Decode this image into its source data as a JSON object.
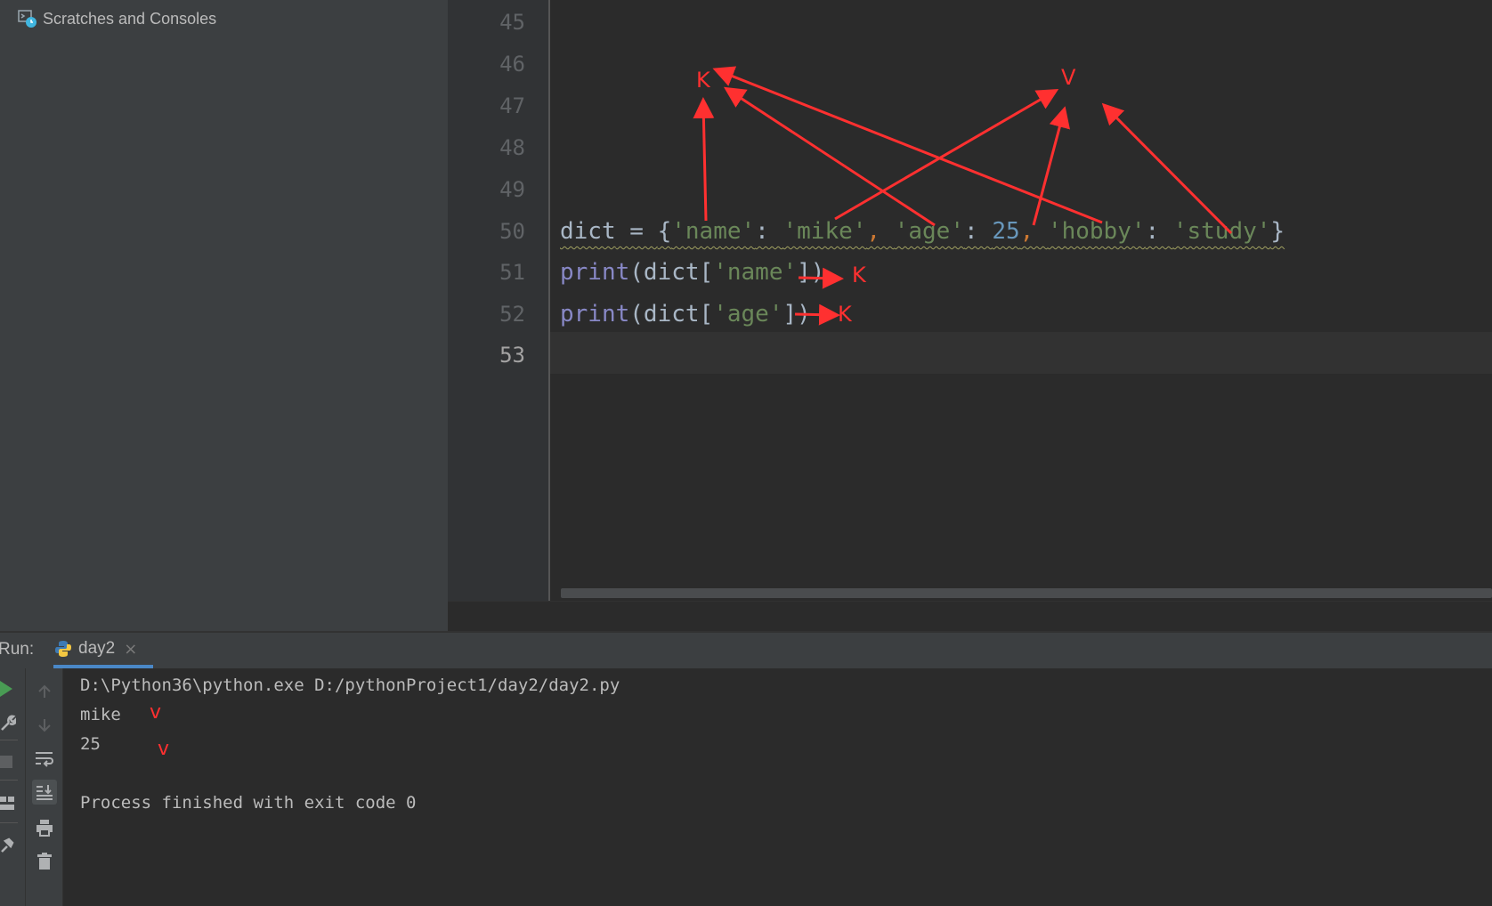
{
  "project": {
    "scratches_label": "Scratches and Consoles"
  },
  "gutter": {
    "lines": [
      "45",
      "46",
      "47",
      "48",
      "49",
      "50",
      "51",
      "52",
      "53"
    ]
  },
  "code": {
    "line50": {
      "var": "dict",
      "eq": " = ",
      "lbrace": "{",
      "k1": "'name'",
      "c1": ": ",
      "v1": "'mike'",
      "s1": ", ",
      "k2": "'age'",
      "c2": ": ",
      "v2": "25",
      "s2": ", ",
      "k3": "'hobby'",
      "c3": ": ",
      "v3": "'study'",
      "rbrace": "}"
    },
    "line51": {
      "fn": "print",
      "open": "(dict[",
      "arg": "'name'",
      "close": "])"
    },
    "line52": {
      "fn": "print",
      "open": "(dict[",
      "arg": "'age'",
      "close": "])"
    }
  },
  "run": {
    "label": "Run:",
    "tab_label": "day2",
    "tab_close": "×"
  },
  "console": {
    "lines": [
      "D:\\Python36\\python.exe D:/pythonProject1/day2/day2.py",
      "mike",
      "25",
      "Process finished with exit code 0"
    ]
  },
  "annotations": {
    "k_top": "K",
    "v_top": "V",
    "k_line51": "K",
    "k_line52": "K",
    "v_mike": "v",
    "v_25": "v"
  },
  "colors": {
    "annotation": "#ff3030",
    "keyword": "#8888c6",
    "string": "#6a8759",
    "number": "#6897bb",
    "punctuation": "#cc7832",
    "run_green": "#499c54"
  },
  "icons": [
    "scratches-icon",
    "python-file-icon",
    "run-icon",
    "wrench-icon",
    "stop-icon",
    "layout-icon",
    "pin-icon",
    "arrow-up-icon",
    "arrow-down-icon",
    "soft-wrap-icon",
    "scroll-to-end-icon",
    "print-icon",
    "trash-icon"
  ]
}
